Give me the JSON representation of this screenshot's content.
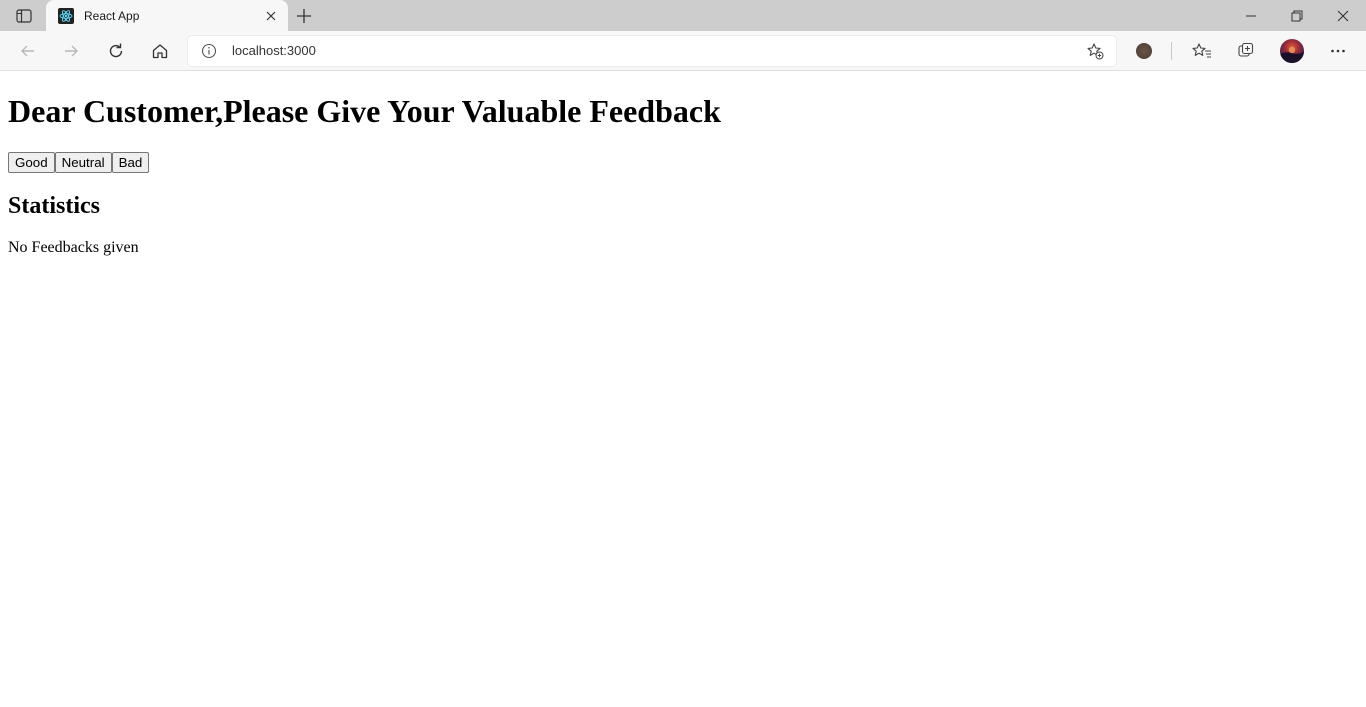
{
  "browser": {
    "tab_title": "React App",
    "url": "localhost:3000"
  },
  "page": {
    "heading": "Dear Customer,Please Give Your Valuable Feedback",
    "buttons": [
      "Good",
      "Neutral",
      "Bad"
    ],
    "stats_title": "Statistics",
    "message": "No Feedbacks given"
  },
  "icons": {
    "tab_actions": "tab-actions-icon",
    "favicon": "react-icon",
    "close": "close-icon",
    "new_tab": "plus-icon",
    "back": "back-arrow-icon",
    "forward": "forward-arrow-icon",
    "refresh": "refresh-icon",
    "home": "home-icon",
    "info": "info-icon",
    "add_favorite": "star-plus-icon",
    "favorites": "favorites-icon",
    "collections": "collections-icon",
    "more": "more-icon"
  },
  "colors": {
    "tabstrip": "#cdcdcd",
    "toolbar": "#f7f7f7",
    "react_blue": "#61dafb"
  }
}
